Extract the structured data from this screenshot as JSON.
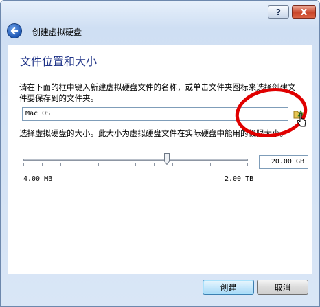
{
  "window": {
    "help_label": "?",
    "close_label": "X",
    "title": "创建虚拟硬盘"
  },
  "page": {
    "section_title": "文件位置和大小",
    "location_description": "请在下面的框中键入新建虚拟硬盘文件的名称，或单击文件夹图标来选择创建文件要保存到的文件夹。",
    "file_name_value": "Mac OS",
    "size_description": "选择虚拟硬盘的大小。此大小为虚拟硬盘文件在实际硬盘中能用的极限大小。",
    "size_value": "20.00 GB",
    "size_min_label": "4.00 MB",
    "size_max_label": "2.00 TB",
    "slider_fraction": 0.64
  },
  "footer": {
    "create_label": "创建",
    "cancel_label": "取消"
  },
  "colors": {
    "accent_title": "#1e3287",
    "annotation_red": "#e00000"
  },
  "icons": {
    "back": "back-arrow-icon",
    "folder": "folder-icon",
    "cursor": "mouse-cursor-icon"
  }
}
